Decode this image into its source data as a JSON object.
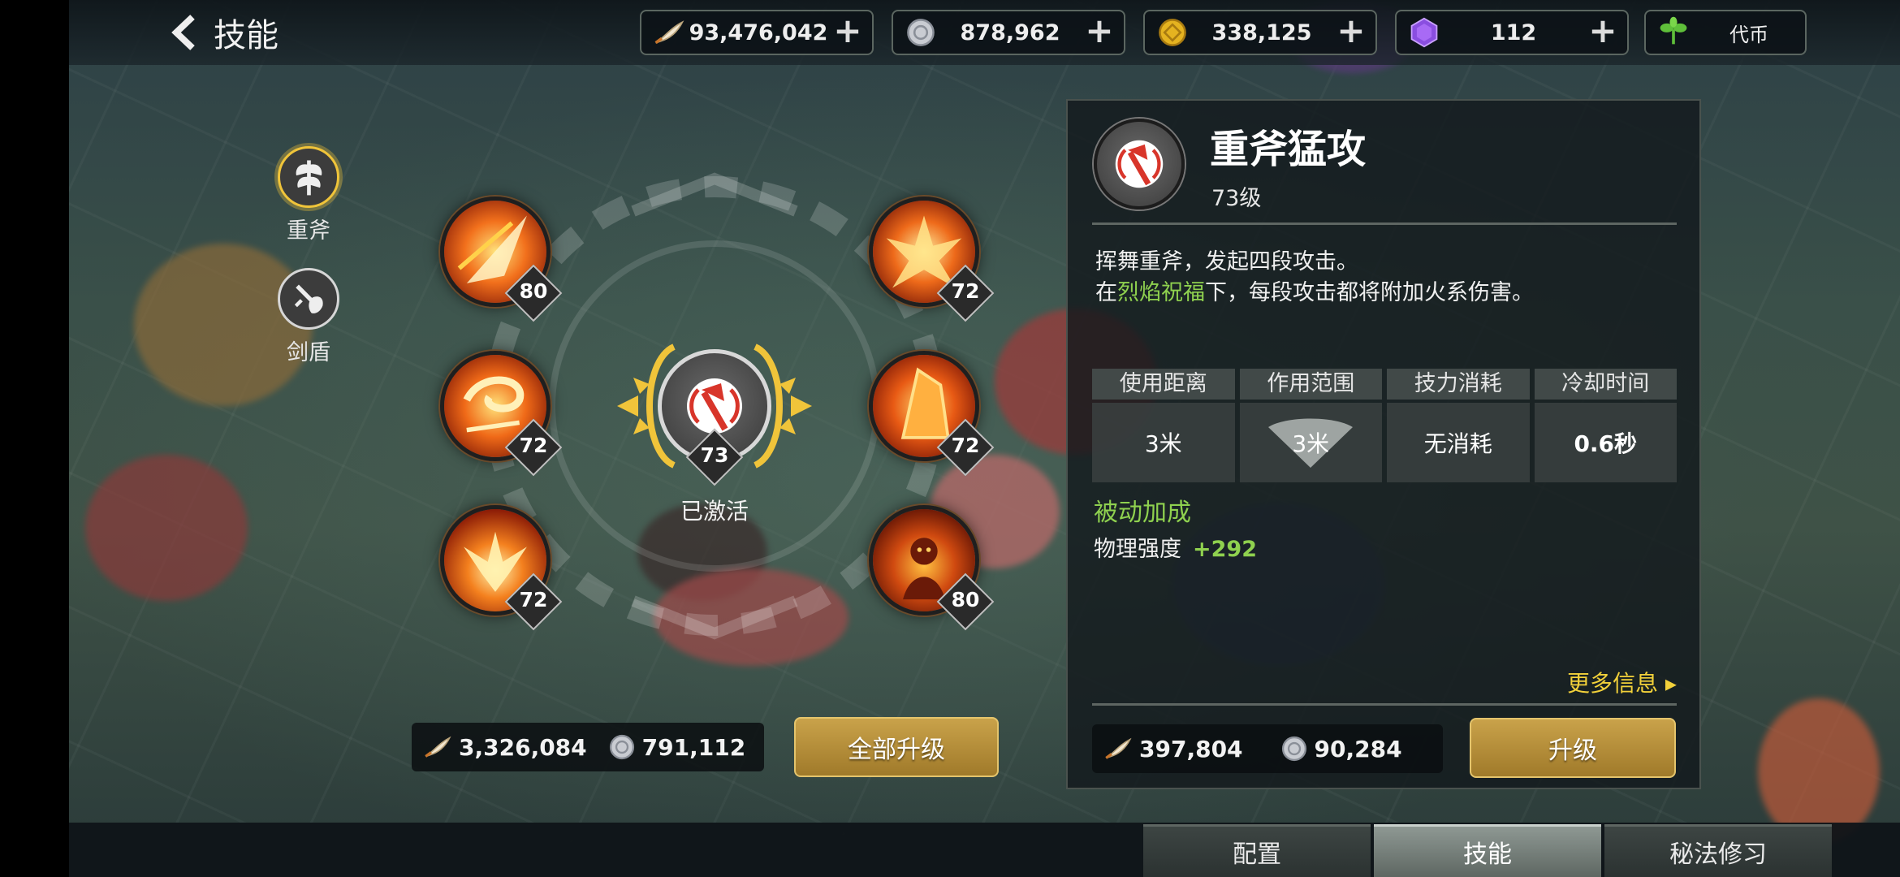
{
  "header": {
    "title": "技能"
  },
  "currencies": [
    {
      "name": "feather",
      "value": "93,476,042"
    },
    {
      "name": "silver-coin",
      "value": "878,962"
    },
    {
      "name": "gold-coin",
      "value": "338,125"
    },
    {
      "name": "purple-gem",
      "value": "112"
    }
  ],
  "tokens": {
    "label": "代币"
  },
  "weapons": [
    {
      "label": "重斧",
      "selected": true
    },
    {
      "label": "剑盾",
      "selected": false
    }
  ],
  "skills": [
    {
      "level": "80",
      "icon": "fire-slash-icon"
    },
    {
      "level": "72",
      "icon": "fire-burst-icon"
    },
    {
      "level": "72",
      "icon": "fire-swirl-icon"
    },
    {
      "level": "72",
      "icon": "fire-crystal-icon"
    },
    {
      "level": "72",
      "icon": "fire-explosion-icon"
    },
    {
      "level": "80",
      "icon": "fire-demon-icon"
    }
  ],
  "active_skill": {
    "level": "73",
    "status": "已激活"
  },
  "total_cost": {
    "feather": "3,326,084",
    "silver": "791,112"
  },
  "upgrade_all_label": "全部升级",
  "detail": {
    "name": "重斧猛攻",
    "level": "73级",
    "desc_line1": "挥舞重斧，发起四段攻击。",
    "desc_line2_pre": "在",
    "desc_line2_hl": "烈焰祝福",
    "desc_line2_post": "下，每段攻击都将附加火系伤害。",
    "stats": [
      {
        "head": "使用距离",
        "value": "3米"
      },
      {
        "head": "作用范围",
        "value": "3米"
      },
      {
        "head": "技力消耗",
        "value": "无消耗"
      },
      {
        "head": "冷却时间",
        "value": "0.6秒"
      }
    ],
    "passive_title": "被动加成",
    "passive_stat": "物理强度",
    "passive_bonus": "+292",
    "more_info": "更多信息 ▸",
    "cost": {
      "feather": "397,804",
      "silver": "90,284"
    },
    "upgrade_label": "升级"
  },
  "tabs": [
    {
      "label": "配置",
      "active": false
    },
    {
      "label": "技能",
      "active": true
    },
    {
      "label": "秘法修习",
      "active": false
    }
  ],
  "colors": {
    "accent_green": "#8fd14f",
    "gold_button": "#b48c38",
    "more_info_yellow": "#f2d13a"
  }
}
